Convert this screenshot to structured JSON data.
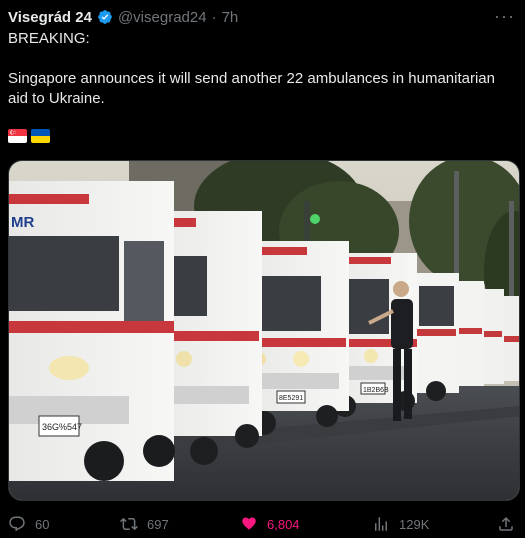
{
  "tweet": {
    "author_name": "Visegrád 24",
    "handle": "@visegrad24",
    "separator": "·",
    "time": "7h",
    "more_label": "···",
    "text_line1": "BREAKING:",
    "text_line2": "Singapore announces it will send another 22 ambulances in humanitarian aid to Ukraine.",
    "flags": [
      "singapore-flag",
      "ukraine-flag"
    ]
  },
  "media": {
    "kind": "photo",
    "texts": {
      "ambulance_logo": "MR",
      "plate_front": "36G%547",
      "plate_middle": "8E5291",
      "plate_right": "1B2B6B"
    }
  },
  "actions": {
    "replies": "60",
    "reposts": "697",
    "likes": "6,804",
    "views": "129K"
  },
  "colors": {
    "background": "#000000",
    "text": "#e7e9ea",
    "muted": "#71767b",
    "verified": "#1d9bf0",
    "like": "#f91880"
  }
}
